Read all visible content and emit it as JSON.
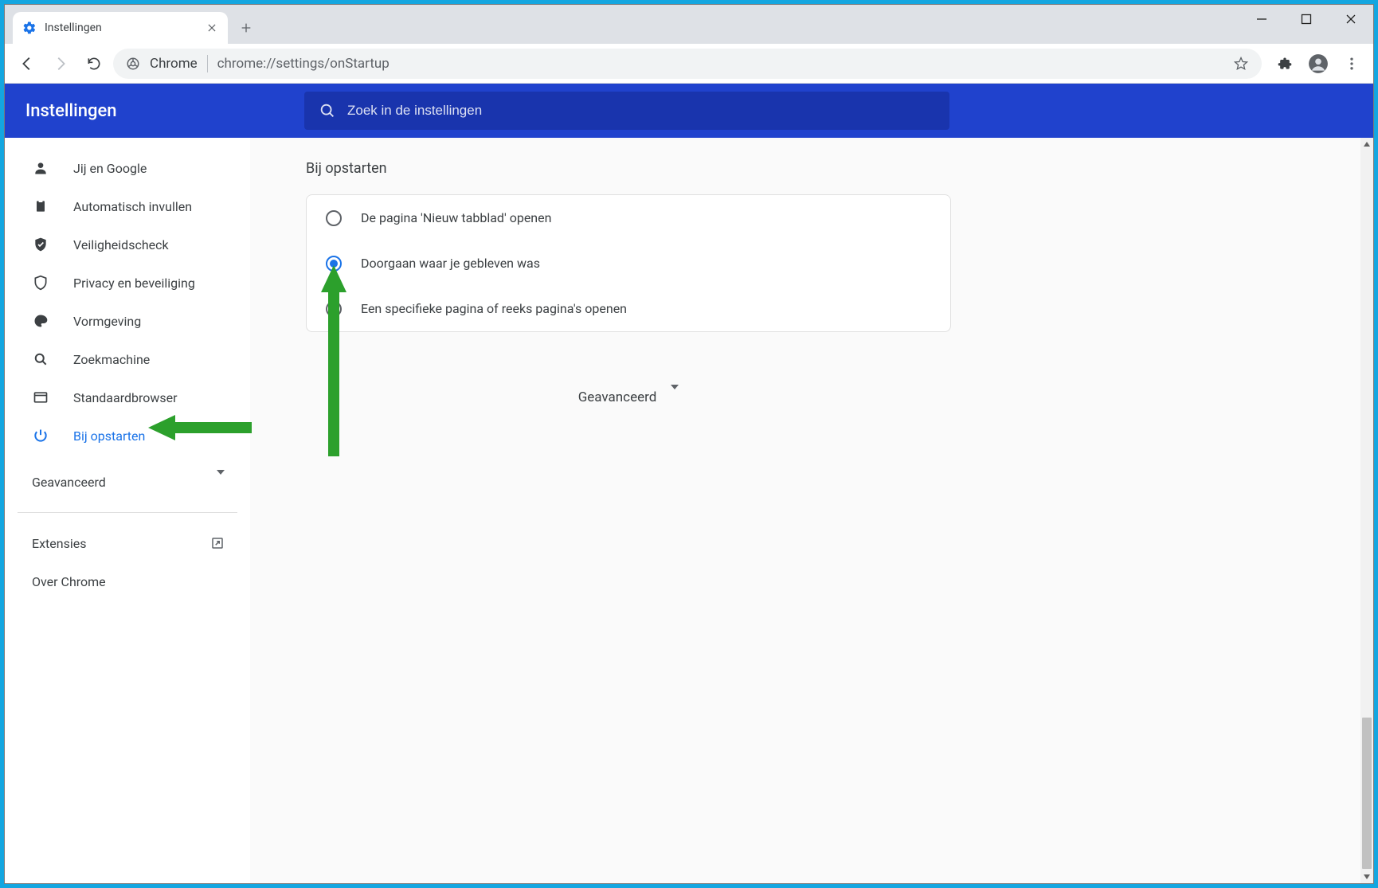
{
  "tab": {
    "title": "Instellingen"
  },
  "omnibox": {
    "protocol_label": "Chrome",
    "url": "chrome://settings/onStartup"
  },
  "settings_header": {
    "title": "Instellingen",
    "search_placeholder": "Zoek in de instellingen"
  },
  "sidebar": {
    "items": [
      {
        "label": "Jij en Google"
      },
      {
        "label": "Automatisch invullen"
      },
      {
        "label": "Veiligheidscheck"
      },
      {
        "label": "Privacy en beveiliging"
      },
      {
        "label": "Vormgeving"
      },
      {
        "label": "Zoekmachine"
      },
      {
        "label": "Standaardbrowser"
      },
      {
        "label": "Bij opstarten"
      }
    ],
    "advanced": "Geavanceerd",
    "extensions": "Extensies",
    "about": "Over Chrome"
  },
  "main": {
    "section_title": "Bij opstarten",
    "options": [
      {
        "label": "De pagina 'Nieuw tabblad' openen"
      },
      {
        "label": "Doorgaan waar je gebleven was"
      },
      {
        "label": "Een specifieke pagina of reeks pagina's openen"
      }
    ],
    "selected_index": 1,
    "advanced_label": "Geavanceerd"
  },
  "colors": {
    "accent": "#1a73e8",
    "header": "#2042cd",
    "annotation": "#2ca02c"
  }
}
